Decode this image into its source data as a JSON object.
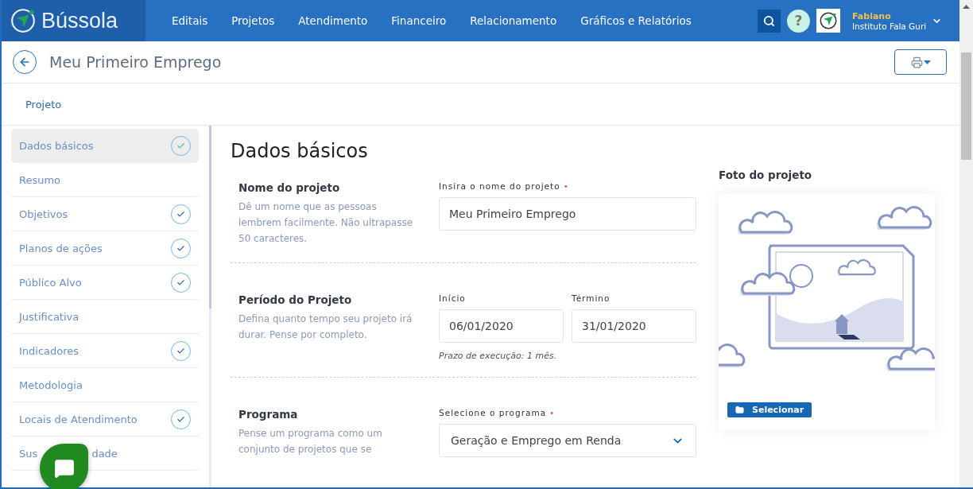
{
  "brand": {
    "name": "Bússola"
  },
  "nav": {
    "items": [
      {
        "label": "Editais"
      },
      {
        "label": "Projetos"
      },
      {
        "label": "Atendimento"
      },
      {
        "label": "Financeiro"
      },
      {
        "label": "Relacionamento"
      },
      {
        "label": "Gráficos e Relatórios"
      }
    ]
  },
  "help": {
    "label": "?"
  },
  "required_mark": "•",
  "user": {
    "name": "Fabiano",
    "organization": "Instituto Fala Guri"
  },
  "page": {
    "title": "Meu Primeiro Emprego"
  },
  "tabs": [
    {
      "label": "Projeto",
      "selected": true
    }
  ],
  "sidebar": {
    "items": [
      {
        "label": "Dados básicos",
        "selected": true,
        "done": true
      },
      {
        "label": "Resumo",
        "selected": false,
        "done": false
      },
      {
        "label": "Objetivos",
        "selected": false,
        "done": true
      },
      {
        "label": "Planos de ações",
        "selected": false,
        "done": true
      },
      {
        "label": "Público Alvo",
        "selected": false,
        "done": true
      },
      {
        "label": "Justificativa",
        "selected": false,
        "done": false
      },
      {
        "label": "Indicadores",
        "selected": false,
        "done": true
      },
      {
        "label": "Metodologia",
        "selected": false,
        "done": false
      },
      {
        "label": "Locais de Atendimento",
        "selected": false,
        "done": true
      },
      {
        "label": "Sus",
        "label_end": "dade",
        "selected": false,
        "done": false
      }
    ]
  },
  "section": {
    "title": "Dados básicos",
    "groups": [
      {
        "kind": "text",
        "title": "Nome do projeto",
        "description": "Dê um nome que as pessoas lembrem facilmente. Não ultrapasse 50 caracteres.",
        "fields": [
          {
            "label": "Insira o nome do projeto",
            "required": true,
            "value": "Meu Primeiro Emprego"
          }
        ]
      },
      {
        "kind": "dates",
        "title": "Período do Projeto",
        "description": "Defina quanto tempo seu projeto irá durar. Pense por completo.",
        "fields": [
          {
            "label": "Início",
            "required": false,
            "value": "06/01/2020"
          },
          {
            "label": "Término",
            "required": false,
            "value": "31/01/2020"
          }
        ],
        "note": "Prazo de execução: 1 mês."
      },
      {
        "kind": "select",
        "title": "Programa",
        "description": "Pense um programa como um conjunto de projetos que se",
        "fields": [
          {
            "label": "Selecione o programa",
            "required": true,
            "value": "Geração e Emprego em Renda"
          }
        ]
      }
    ]
  },
  "photo": {
    "title": "Foto do projeto",
    "button": "Selecionar"
  }
}
